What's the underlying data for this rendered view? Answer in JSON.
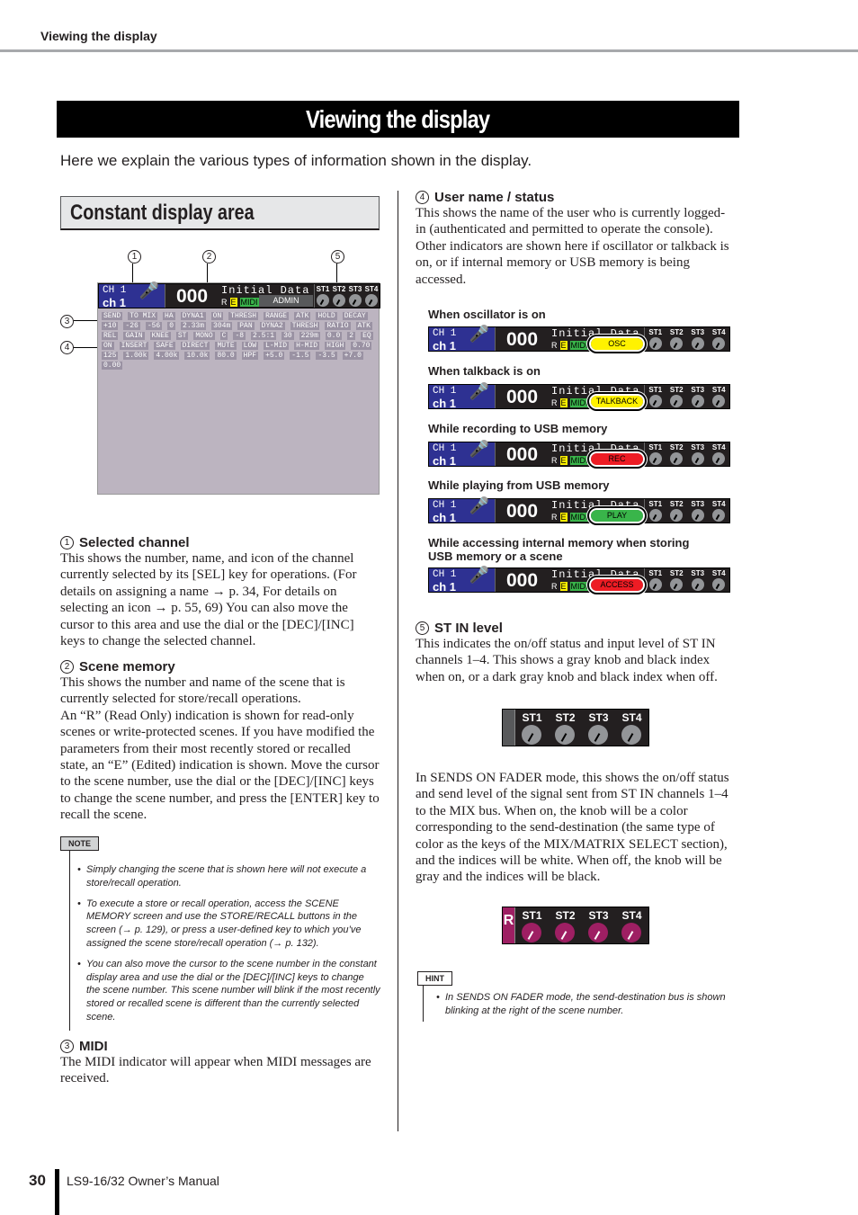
{
  "running_header": "Viewing the display",
  "title": "Viewing the display",
  "intro": "Here we explain the various types of information shown in the display.",
  "section_title": "Constant display area",
  "display": {
    "ch_label": "CH 1",
    "ch_name": "ch 1",
    "scene_number": "000",
    "scene_name": "Initial Data",
    "r": "R",
    "e": "E",
    "midi": "MIDI",
    "user": "ADMIN",
    "st": [
      "ST1",
      "ST2",
      "ST3",
      "ST4"
    ],
    "callouts": [
      "1",
      "2",
      "3",
      "4",
      "5"
    ],
    "panel_labels": [
      "SEND",
      "TO MIX",
      "HA",
      "DYNA1",
      "ON",
      "THRESH",
      "RANGE",
      "ATK",
      "HOLD",
      "DECAY",
      "+10",
      "-26",
      "-56",
      "0",
      "2.33m",
      "304m",
      "PAN",
      "DYNA2",
      "THRESH",
      "RATIO",
      "ATK",
      "REL",
      "GAIN",
      "KNEE",
      "ST",
      "MONO",
      "C",
      "-8",
      "2.5:1",
      "30",
      "229m",
      "0.0",
      "2",
      "EQ",
      "ON",
      "INSERT",
      "SAFE",
      "DIRECT",
      "MUTE",
      "LOW",
      "L-MID",
      "H-MID",
      "HIGH",
      "0.70",
      "125",
      "1.00k",
      "4.00k",
      "10.0k",
      "80.0",
      "HPF",
      "+5.0",
      "-1.5",
      "-3.5",
      "+7.0",
      "0.00"
    ]
  },
  "left": {
    "s1": {
      "num": "1",
      "title": "Selected channel",
      "body": "This shows the number, name, and icon of the channel currently selected by its [SEL] key for operations. (For details on assigning a name → p. 34, For details on selecting an icon → p. 55, 69) You can also move the cursor to this area and use the dial or the [DEC]/[INC] keys to change the selected channel."
    },
    "s2": {
      "num": "2",
      "title": "Scene memory",
      "body": "This shows the number and name of the scene that is currently selected for store/recall operations.",
      "body2": "An “R” (Read Only) indication is shown for read-only scenes or write-protected scenes. If you have modified the parameters from their most recently stored or recalled state, an “E” (Edited) indication is shown. Move the cursor to the scene number, use the dial or the [DEC]/[INC] keys to change the scene number, and press the [ENTER] key to recall the scene."
    },
    "note": {
      "tag": "NOTE",
      "items": [
        "Simply changing the scene that is shown here will not execute a store/recall operation.",
        "To execute a store or recall operation, access the SCENE MEMORY screen and use the STORE/RECALL buttons in the screen (→ p. 129), or press a user-defined key to which you’ve assigned the scene store/recall operation (→ p. 132).",
        "You can also move the cursor to the scene number in the constant display area and use the dial or the [DEC]/[INC] keys to change the scene number. This scene number will blink if the most recently stored or recalled scene is different than the currently selected scene."
      ]
    },
    "s3": {
      "num": "3",
      "title": "MIDI",
      "body": "The MIDI indicator will appear when MIDI messages are received."
    }
  },
  "right": {
    "s4": {
      "num": "4",
      "title": "User name / status",
      "body": "This shows the name of the user who is currently logged-in (authenticated and permitted to operate the console). Other indicators are shown here if oscillator or talkback is on, or if internal memory or USB memory is being accessed."
    },
    "states": [
      {
        "caption": "When oscillator is on",
        "status": "OSC",
        "color": "#fff200"
      },
      {
        "caption": "When talkback is on",
        "status": "TALKBACK",
        "color": "#fff200"
      },
      {
        "caption": "While recording to USB memory",
        "status": "REC",
        "color": "#ed1c24"
      },
      {
        "caption": "While playing from USB memory",
        "status": "PLAY",
        "color": "#39b54a"
      },
      {
        "caption": "While accessing internal memory when storing USB memory or a scene",
        "status": "ACCESS",
        "color": "#ed1c24"
      }
    ],
    "s5": {
      "num": "5",
      "title": "ST IN level",
      "body": "This indicates the on/off status and input level of ST IN channels 1–4. This shows a gray knob and black index when on, or a dark gray knob and black index when off.",
      "body2": "In SENDS ON FADER mode, this shows the on/off status and send level of the signal sent from ST IN channels 1–4 to the MIX bus. When on, the knob will be a color corresponding to the send-destination (the same type of color as the keys of the MIX/MATRIX SELECT section), and the indices will be white. When off, the knob will be gray and the indices will be black."
    },
    "sof_r": "R",
    "hint": {
      "tag": "HINT",
      "items": [
        "In SENDS ON FADER mode, the send-destination bus is shown blinking at the right of the scene number."
      ]
    }
  },
  "footer": {
    "page": "30",
    "manual": "LS9-16/32  Owner’s Manual"
  }
}
